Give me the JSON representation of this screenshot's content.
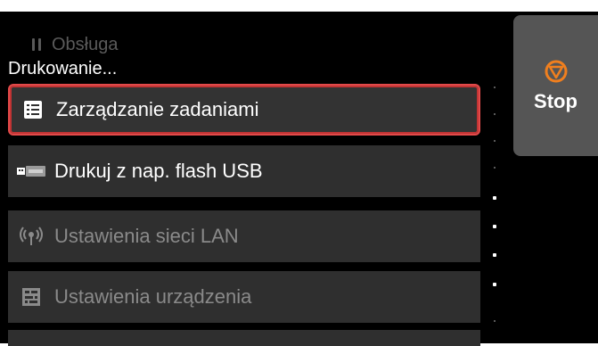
{
  "header": {
    "ghost_title": "Obsługa",
    "status": "Drukowanie..."
  },
  "menu": {
    "items": [
      {
        "label": "Zarządzanie zadaniami",
        "icon": "job-list-icon",
        "state": "selected"
      },
      {
        "label": "Drukuj z nap. flash USB",
        "icon": "usb-icon",
        "state": "enabled"
      },
      {
        "label": "Ustawienia sieci LAN",
        "icon": "wireless-icon",
        "state": "disabled"
      },
      {
        "label": "Ustawienia urządzenia",
        "icon": "device-settings-icon",
        "state": "disabled"
      }
    ]
  },
  "stop": {
    "label": "Stop",
    "icon": "stop-icon",
    "accent": "#f07f1e"
  },
  "colors": {
    "selection": "#e24a4a",
    "item_bg": "#2f2f2f",
    "background": "#000000",
    "disabled_text": "#8a8a8a"
  }
}
